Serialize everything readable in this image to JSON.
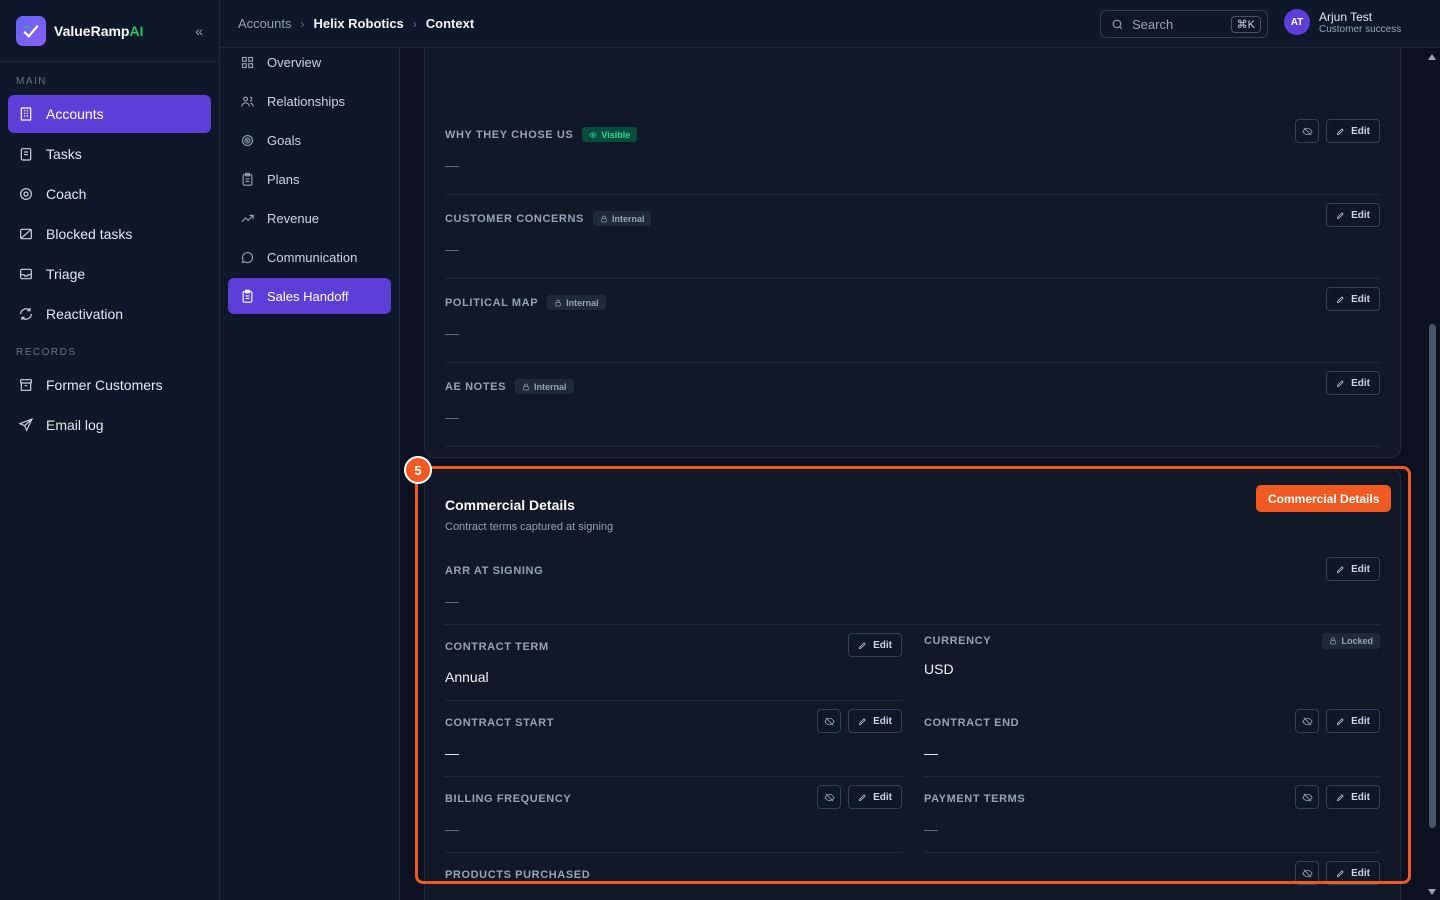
{
  "brand": {
    "name_main": "ValueRamp",
    "name_accent": "AI"
  },
  "sidebar": {
    "main_label": "MAIN",
    "records_label": "RECORDS",
    "main_items": [
      {
        "label": "Accounts",
        "icon": "building-icon"
      },
      {
        "label": "Tasks",
        "icon": "clipboard-icon"
      },
      {
        "label": "Coach",
        "icon": "target-icon"
      },
      {
        "label": "Blocked tasks",
        "icon": "blocked-icon"
      },
      {
        "label": "Triage",
        "icon": "inbox-icon"
      },
      {
        "label": "Reactivation",
        "icon": "refresh-icon"
      }
    ],
    "record_items": [
      {
        "label": "Former Customers",
        "icon": "archive-icon"
      },
      {
        "label": "Email log",
        "icon": "send-icon"
      }
    ]
  },
  "breadcrumb": [
    "Accounts",
    "Helix Robotics",
    "Context"
  ],
  "search": {
    "placeholder": "Search",
    "shortcut": "⌘K"
  },
  "user": {
    "initials": "AT",
    "name": "Arjun Test",
    "role": "Customer success"
  },
  "subnav": [
    {
      "label": "Overview",
      "icon": "grid-icon"
    },
    {
      "label": "Relationships",
      "icon": "users-icon"
    },
    {
      "label": "Goals",
      "icon": "target-icon"
    },
    {
      "label": "Plans",
      "icon": "clipboard-icon"
    },
    {
      "label": "Revenue",
      "icon": "trending-icon"
    },
    {
      "label": "Communication",
      "icon": "chat-icon"
    },
    {
      "label": "Sales Handoff",
      "icon": "clipboard-icon"
    }
  ],
  "top_fields": [
    {
      "label": "WHY THEY CHOSE US",
      "badge": "Visible",
      "value": "—"
    },
    {
      "label": "CUSTOMER CONCERNS",
      "badge": "Internal",
      "value": "—"
    },
    {
      "label": "POLITICAL MAP",
      "badge": "Internal",
      "value": "—"
    },
    {
      "label": "AE NOTES",
      "badge": "Internal",
      "value": "—"
    }
  ],
  "edit_label": "Edit",
  "commercial": {
    "title": "Commercial Details",
    "subtitle": "Contract terms captured at signing",
    "arr": {
      "label": "ARR AT SIGNING",
      "value": "—"
    },
    "contract_term": {
      "label": "CONTRACT TERM",
      "value": "Annual"
    },
    "currency": {
      "label": "CURRENCY",
      "value": "USD",
      "badge": "Locked"
    },
    "contract_start": {
      "label": "CONTRACT START",
      "value": "—"
    },
    "contract_end": {
      "label": "CONTRACT END",
      "value": "—"
    },
    "billing_frequency": {
      "label": "BILLING FREQUENCY",
      "value": "—"
    },
    "payment_terms": {
      "label": "PAYMENT TERMS",
      "value": "—"
    },
    "products": {
      "label": "PRODUCTS PURCHASED"
    }
  },
  "highlight": {
    "number": "5",
    "label": "Commercial Details"
  },
  "colors": {
    "accent": "#5b3fd6",
    "highlight": "#f05a22",
    "visible": "#34d399"
  }
}
